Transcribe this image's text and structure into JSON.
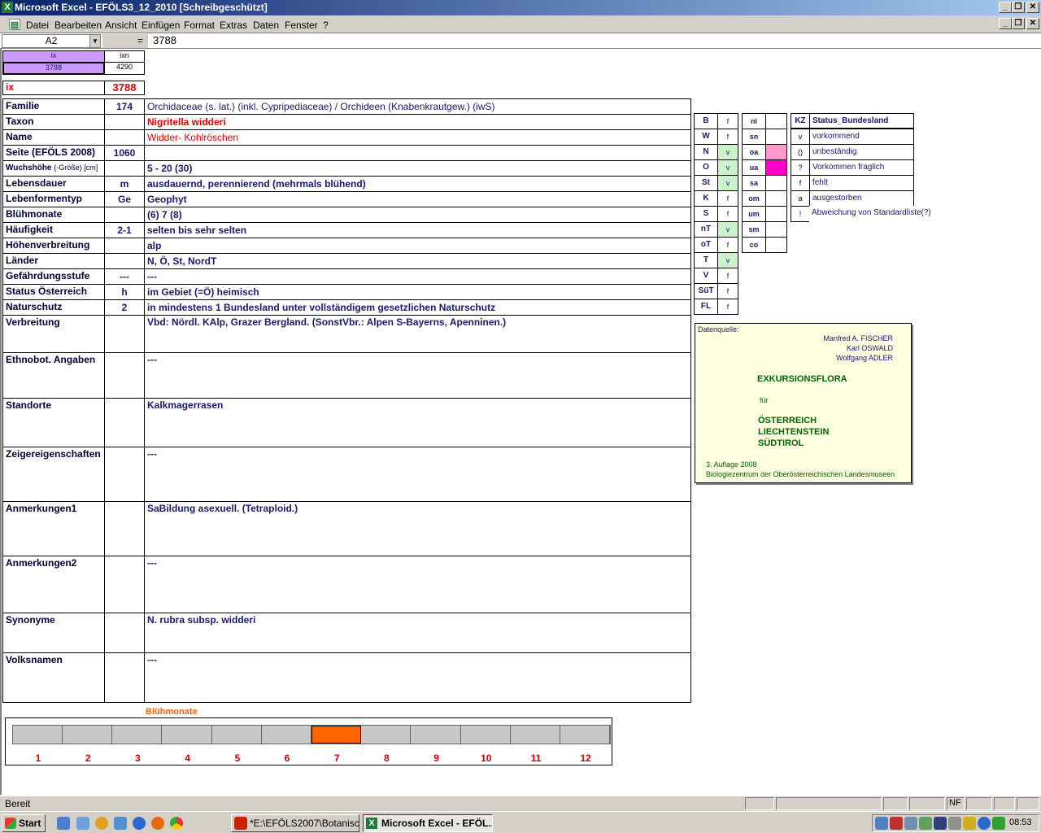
{
  "window": {
    "title": "Microsoft Excel - EFÖLS3_12_2010  [Schreibgeschützt]"
  },
  "menu": [
    "Datei",
    "Bearbeiten",
    "Ansicht",
    "Einfügen",
    "Format",
    "Extras",
    "Daten",
    "Fenster",
    "?"
  ],
  "formula": {
    "namebox": "A2",
    "fx": "=",
    "value": "3788"
  },
  "top": {
    "ix_h": "ix",
    "ixn_h": "ixn",
    "ix_v": "3788",
    "ixn_v": "4290",
    "ix_label": "ix",
    "ix_big": "3788"
  },
  "rows": [
    {
      "label": "Familie",
      "code": "174",
      "value": "Orchidaceae (s. lat.) (inkl. Cypripediaceae)  /  Orchideen (Knabenkrautgew.) (iwS)"
    },
    {
      "label": "Taxon",
      "code": "",
      "value": "Nigritella widderi"
    },
    {
      "label": "Name",
      "code": "",
      "value": "Widder- Kohlröschen"
    },
    {
      "label": "Seite (EFÖLS 2008)",
      "code": "1060",
      "value": ""
    },
    {
      "label": "Wuchshöhe",
      "label_suffix": "(-Größe) [cm]",
      "code": "",
      "value": " 5 - 20 (30)"
    },
    {
      "label": "Lebensdauer",
      "code": "m",
      "value": "ausdauernd, perennierend (mehrmals blühend)"
    },
    {
      "label": "Lebenformentyp",
      "code": "Ge",
      "value": "Geophyt"
    },
    {
      "label": "Blühmonate",
      "code": "",
      "value": "(6) 7 (8)"
    },
    {
      "label": "Häufigkeit",
      "code": "2-1",
      "value": "selten bis sehr selten"
    },
    {
      "label": "Höhenverbreitung",
      "code": "",
      "value": "alp"
    },
    {
      "label": "Länder",
      "code": "",
      "value": "N, Ö, St, NordT"
    },
    {
      "label": "Gefährdungsstufe",
      "code": "---",
      "value": " ---"
    },
    {
      "label": "Status Österreich",
      "code": "h",
      "value": "im Gebiet (=Ö) heimisch"
    },
    {
      "label": "Naturschutz",
      "code": "2",
      "value": "in mindestens 1 Bundesland unter vollständigem gesetzlichen Naturschutz"
    }
  ],
  "tallrows": [
    {
      "label": "Verbreitung",
      "value": "Vbd: Nördl. KAlp, Grazer Bergland.  (SonstVbr.: Alpen S-Bayerns, Apenninen.)"
    },
    {
      "label": "Ethnobot. Angaben",
      "value": "---"
    },
    {
      "label": "Standorte",
      "value": "Kalkmagerrasen"
    },
    {
      "label": "Zeigereigenschaften",
      "value": "---"
    },
    {
      "label": "Anmerkungen1",
      "value": "SaBildung asexuell. (Tetraploid.)"
    },
    {
      "label": "Anmerkungen2",
      "value": "---"
    },
    {
      "label": "Synonyme",
      "value": "N. rubra subsp. widderi"
    },
    {
      "label": "Volksnamen",
      "value": "---"
    }
  ],
  "states": [
    {
      "k": "B",
      "v": "f"
    },
    {
      "k": "W",
      "v": "f"
    },
    {
      "k": "N",
      "v": "v"
    },
    {
      "k": "O",
      "v": "v"
    },
    {
      "k": "St",
      "v": "v"
    },
    {
      "k": "K",
      "v": "f"
    },
    {
      "k": "S",
      "v": "f"
    },
    {
      "k": "nT",
      "v": "v"
    },
    {
      "k": "oT",
      "v": "f"
    },
    {
      "k": "T",
      "v": "v"
    },
    {
      "k": "V",
      "v": "f"
    },
    {
      "k": "SüT",
      "v": "f"
    },
    {
      "k": "FL",
      "v": "f"
    }
  ],
  "regions": [
    "ni",
    "sn",
    "oa",
    "ua",
    "sa",
    "om",
    "um",
    "sm",
    "co"
  ],
  "legend": {
    "h_kz": "KZ",
    "h_status": "Status_Bundesland",
    "items": [
      {
        "k": "v",
        "t": "vorkommend"
      },
      {
        "k": "()",
        "t": "unbeständig"
      },
      {
        "k": "?",
        "t": "Vorkommen fraglich"
      },
      {
        "k": "f",
        "t": "fehlt"
      },
      {
        "k": "a",
        "t": "ausgestorben"
      },
      {
        "k": "!",
        "t": "Abweichung von Standardliste(?)"
      }
    ]
  },
  "source": {
    "head": "Datenquelle:",
    "authors": [
      "Manfred A. FISCHER",
      "Karl OSWALD",
      "Wolfgang ADLER"
    ],
    "title": "EXKURSIONSFLORA",
    "fuer": "für",
    "countries": [
      "ÖSTERREICH",
      "LIECHTENSTEIN",
      "SÜDTIROL"
    ],
    "ed": "3. Auflage 2008",
    "pub": "Biologiezentrum der Oberösterreichischen Landesmuseen"
  },
  "bloom": {
    "title": "Blühmonate",
    "months": [
      "1",
      "2",
      "3",
      "4",
      "5",
      "6",
      "7",
      "8",
      "9",
      "10",
      "11",
      "12"
    ],
    "active_month": 7,
    "active_color": "#ff6600"
  },
  "status": {
    "text": "Bereit",
    "nf": "NF"
  },
  "taskbar": {
    "start": "Start",
    "tasks": [
      "*E:\\EFÖLS2007\\Botanisc...",
      "Microsoft Excel - EFÖL..."
    ],
    "clock": "08:53"
  }
}
